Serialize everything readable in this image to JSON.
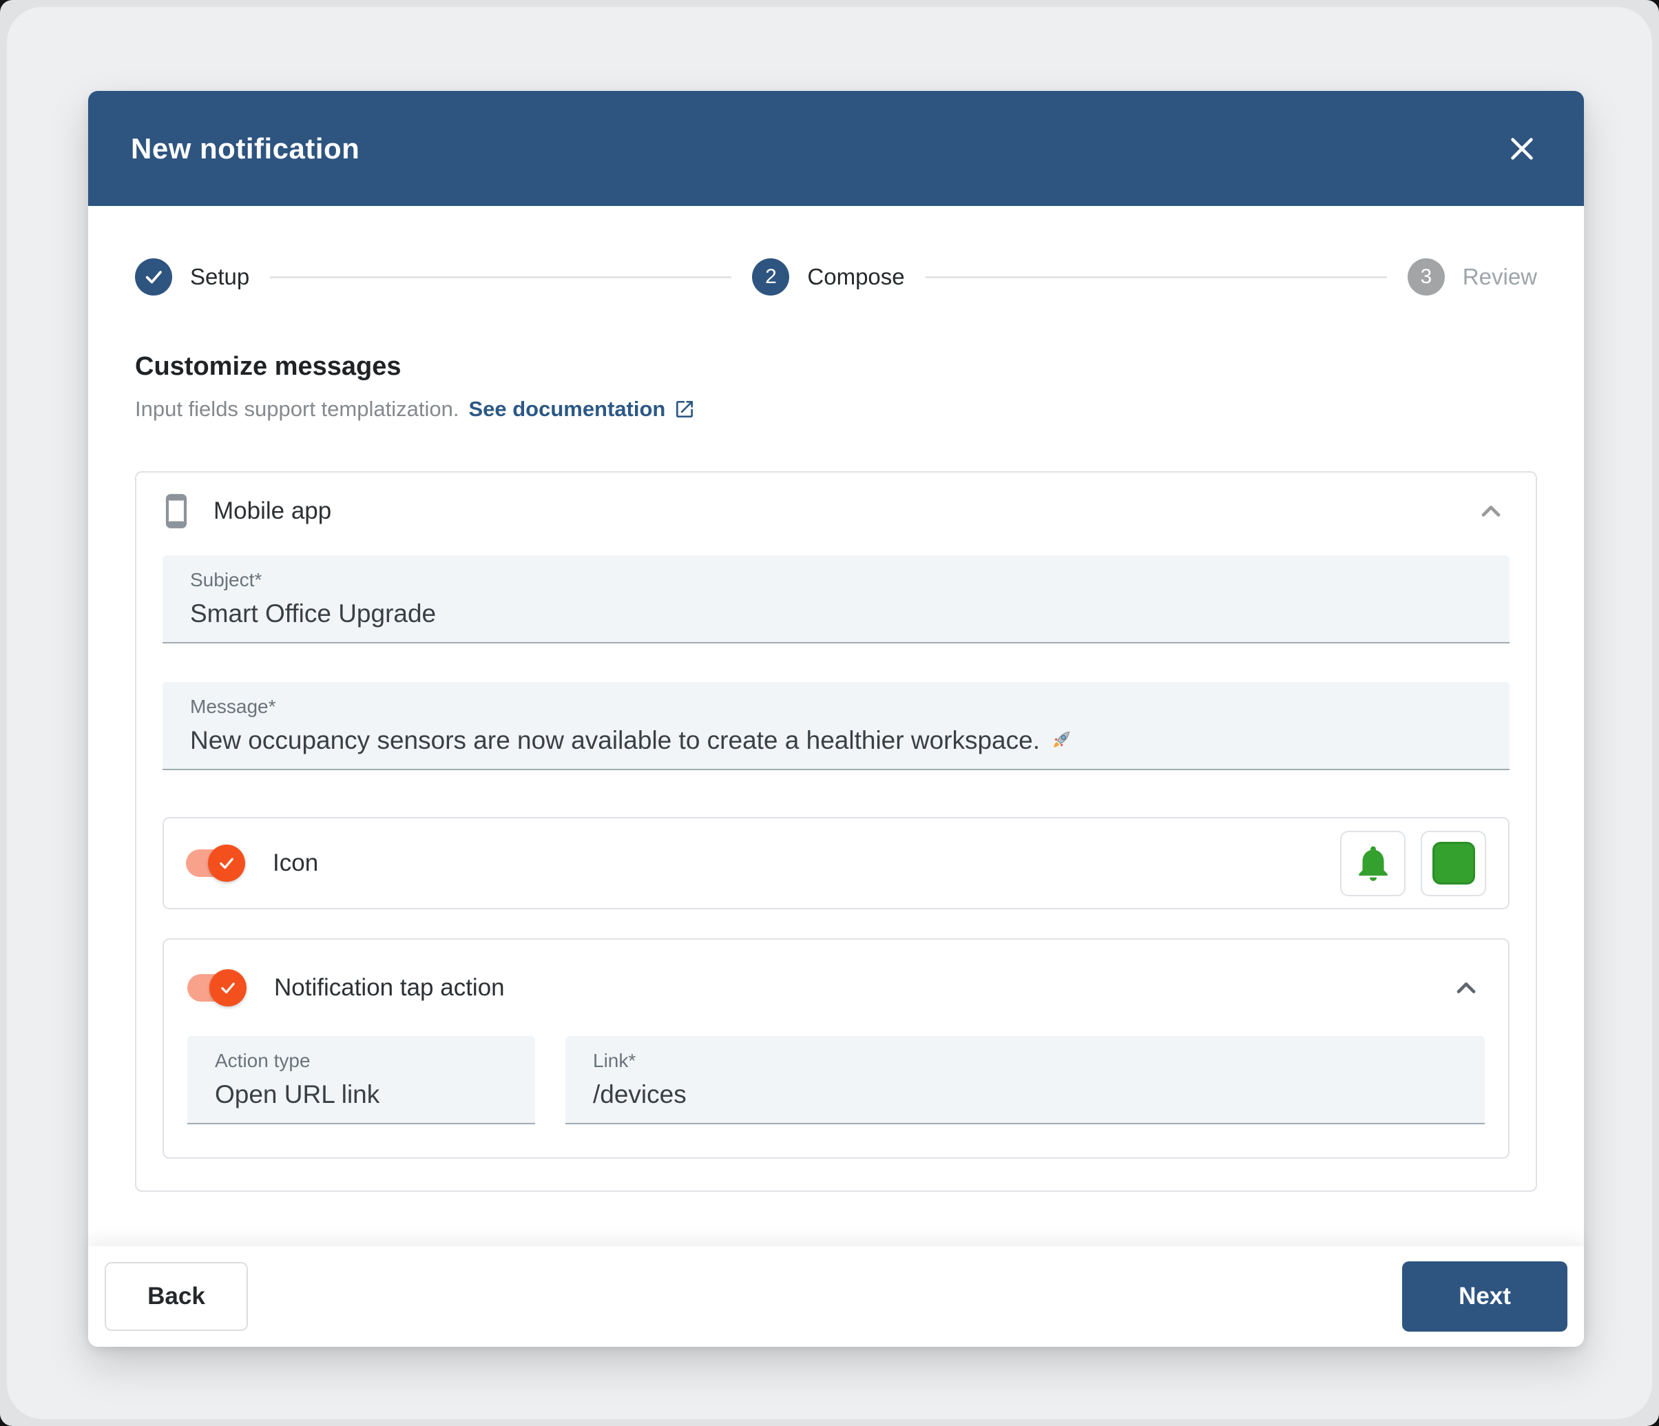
{
  "modal": {
    "title": "New notification"
  },
  "stepper": {
    "steps": [
      {
        "label": "Setup",
        "state": "complete",
        "number": ""
      },
      {
        "label": "Compose",
        "state": "active",
        "number": "2"
      },
      {
        "label": "Review",
        "state": "upcoming",
        "number": "3"
      }
    ]
  },
  "section": {
    "heading": "Customize messages",
    "subtitle": "Input fields support templatization.",
    "doc_link_label": "See documentation"
  },
  "mobile_card": {
    "title": "Mobile app",
    "subject": {
      "label": "Subject*",
      "value": "Smart Office Upgrade"
    },
    "message": {
      "label": "Message*",
      "value": "New occupancy sensors are now available to create a healthier workspace.",
      "emoji": "🚀"
    },
    "icon_row": {
      "label": "Icon",
      "enabled": true
    },
    "tap_action": {
      "label": "Notification tap action",
      "enabled": true,
      "action_type": {
        "label": "Action type",
        "value": "Open URL link"
      },
      "link": {
        "label": "Link*",
        "value": "/devices"
      }
    }
  },
  "footer": {
    "back_label": "Back",
    "next_label": "Next"
  },
  "colors": {
    "header_blue": "#2e5480",
    "accent_orange": "#f4501e",
    "toggle_track": "#f8a28c",
    "icon_green": "#34a02e",
    "inactive_gray": "#a2a4a6",
    "link_blue": "#2c5885"
  }
}
